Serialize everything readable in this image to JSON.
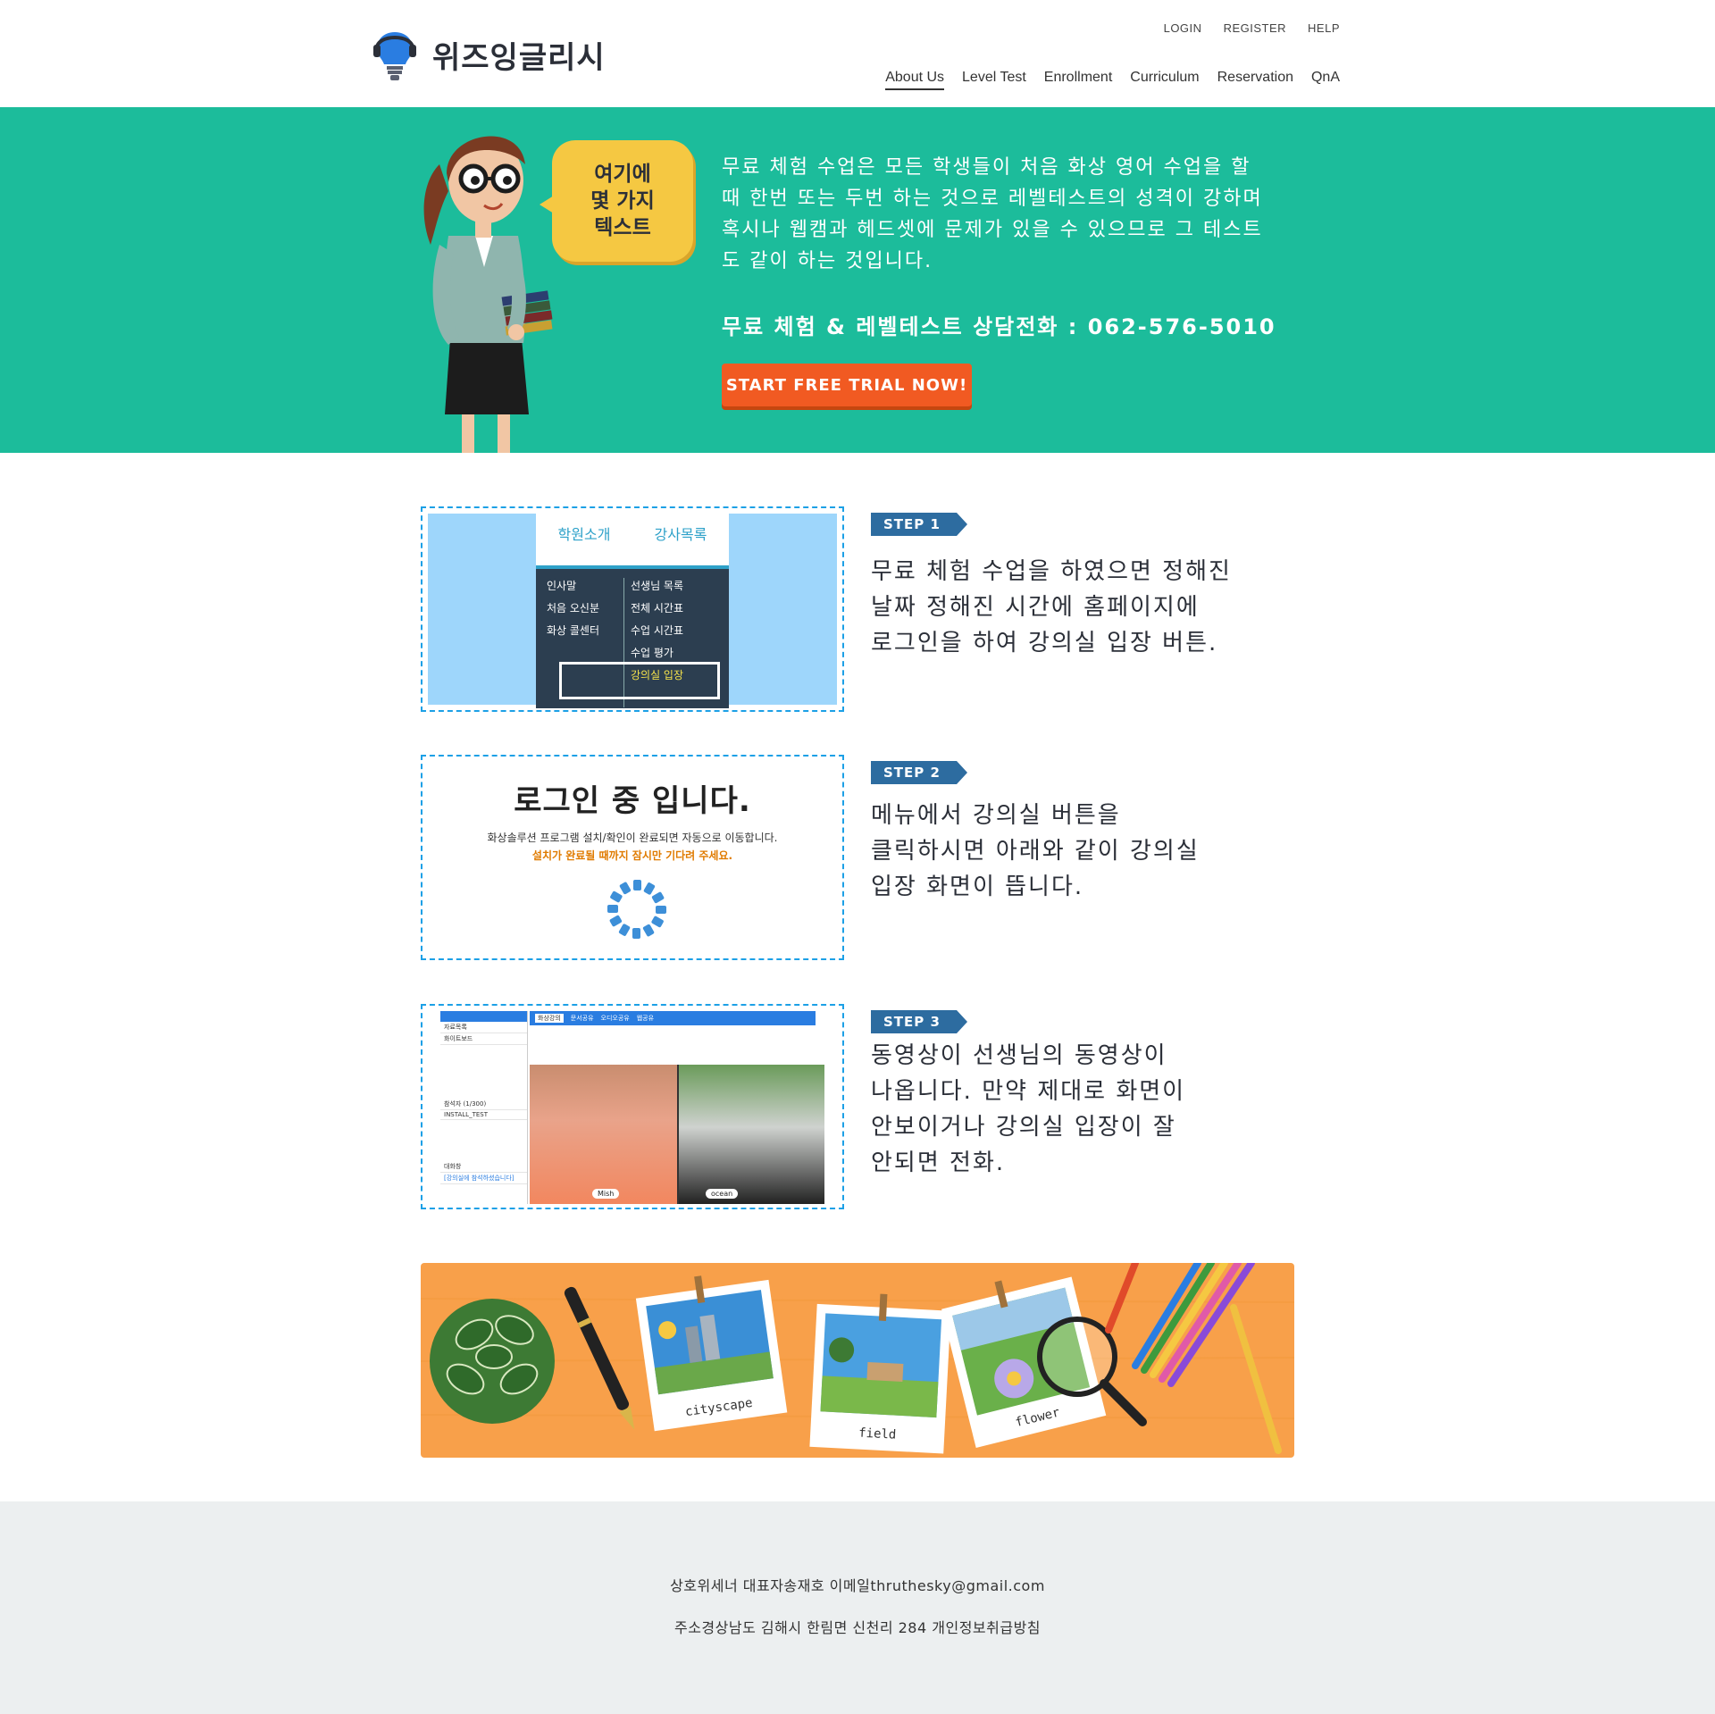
{
  "header": {
    "logo_text": "위즈잉글리시",
    "top_links": [
      "LOGIN",
      "REGISTER",
      "HELP"
    ],
    "nav": [
      "About Us",
      "Level Test",
      "Enrollment",
      "Curriculum",
      "Reservation",
      "QnA"
    ],
    "active_nav": "About Us"
  },
  "hero": {
    "bubble_text": "여기에\n몇 가지\n텍스트",
    "description": "무료 체험 수업은 모든 학생들이 처음 화상 영어 수업을 할 때 한번 또는 두번 하는 것으로 레벨테스트의 성격이 강하며 혹시나 웹캠과 헤드셋에 문제가 있을 수 있으므로 그 테스트도 같이 하는 것입니다.",
    "phone_line": "무료 체험 & 레벨테스트 상담전화 : 062-576-5010",
    "cta_label": "START FREE TRIAL NOW!",
    "bg_color": "#1cbc9b",
    "cta_color": "#f15a22"
  },
  "steps": [
    {
      "tag": "STEP 1",
      "text": "무료 체험 수업을 하였으면 정해진\n날짜 정해진 시간에 홈페이지에\n로그인을 하여 강의실 입장 버튼.",
      "mock": {
        "menu_top": [
          "학원소개",
          "강사목록"
        ],
        "left_items": [
          "인사말",
          "처음 오신분",
          "화상 콜센터"
        ],
        "right_items": [
          "선생님 목록",
          "전체 시간표",
          "수업 시간표",
          "수업 평가",
          "강의실 입장"
        ]
      }
    },
    {
      "tag": "STEP 2",
      "text": "메뉴에서 강의실 버튼을\n클릭하시면 아래와 같이 강의실\n입장 화면이 뜹니다.",
      "mock": {
        "title": "로그인 중 입니다.",
        "sub1": "화상솔루션 프로그램 설치/확인이 완료되면 자동으로 이동합니다.",
        "sub2": "설치가 완료될 때까지 잠시만 기다려 주세요."
      }
    },
    {
      "tag": "STEP 3",
      "text": "동영상이 선생님의 동영상이\n나옵니다. 만약 제대로 화면이\n안보이거나 강의실 입장이 잘\n안되면 전화.",
      "mock": {
        "tabs": [
          "화상강의",
          "문서공유",
          "오디오공유",
          "웹공유"
        ],
        "left_rows": [
          "자료목록",
          "화이트보드",
          "참석자 (1/300)",
          "INSTALL_TEST",
          "대화창",
          "[강의실에 참석하셨습니다]"
        ],
        "name1": "Mish",
        "name2": "ocean"
      }
    }
  ],
  "banner": {
    "labels": [
      "cityscape",
      "field",
      "flower"
    ]
  },
  "footer": {
    "line1": "상호위세너 대표자송재호 이메일thruthesky@gmail.com",
    "line2": "주소경상남도 김해시 한림면 신천리 284 개인정보취급방침"
  }
}
